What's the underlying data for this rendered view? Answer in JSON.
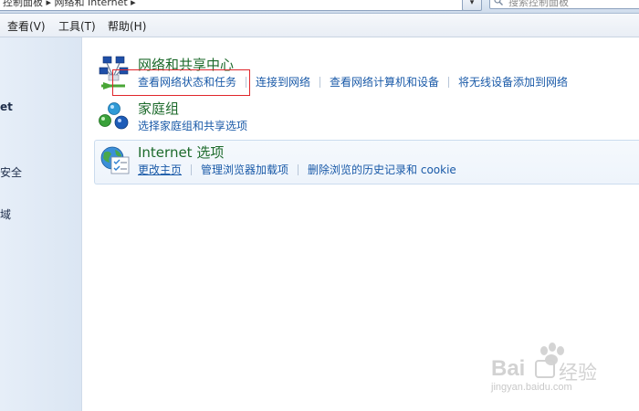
{
  "address_bar": {
    "text": "控制面板 ▸ 网络和 Internet ▸",
    "dropdown": "▾",
    "search_placeholder": "搜索控制面板"
  },
  "menu": [
    {
      "label": "查看(V)"
    },
    {
      "label": "工具(T)"
    },
    {
      "label": "帮助(H)"
    }
  ],
  "left_nav": [
    {
      "label": "et"
    },
    {
      "label": "安全"
    },
    {
      "label": "域"
    }
  ],
  "groups": {
    "network": {
      "title": "网络和共享中心",
      "links": [
        "查看网络状态和任务",
        "连接到网络",
        "查看网络计算机和设备",
        "将无线设备添加到网络"
      ]
    },
    "homegroup": {
      "title": "家庭组",
      "links": [
        "选择家庭组和共享选项"
      ]
    },
    "internet": {
      "title": "Internet 选项",
      "links": [
        "更改主页",
        "管理浏览器加载项",
        "删除浏览的历史记录和 cookie"
      ]
    }
  },
  "watermark": {
    "brand": "Bai",
    "brand2": "经验",
    "url": "jingyan.baidu.com"
  },
  "colors": {
    "title_green": "#1c6a2b",
    "link_blue": "#1a5aa8",
    "annotation_red": "#e0262b",
    "nav_bg": "#e2ebf6"
  }
}
